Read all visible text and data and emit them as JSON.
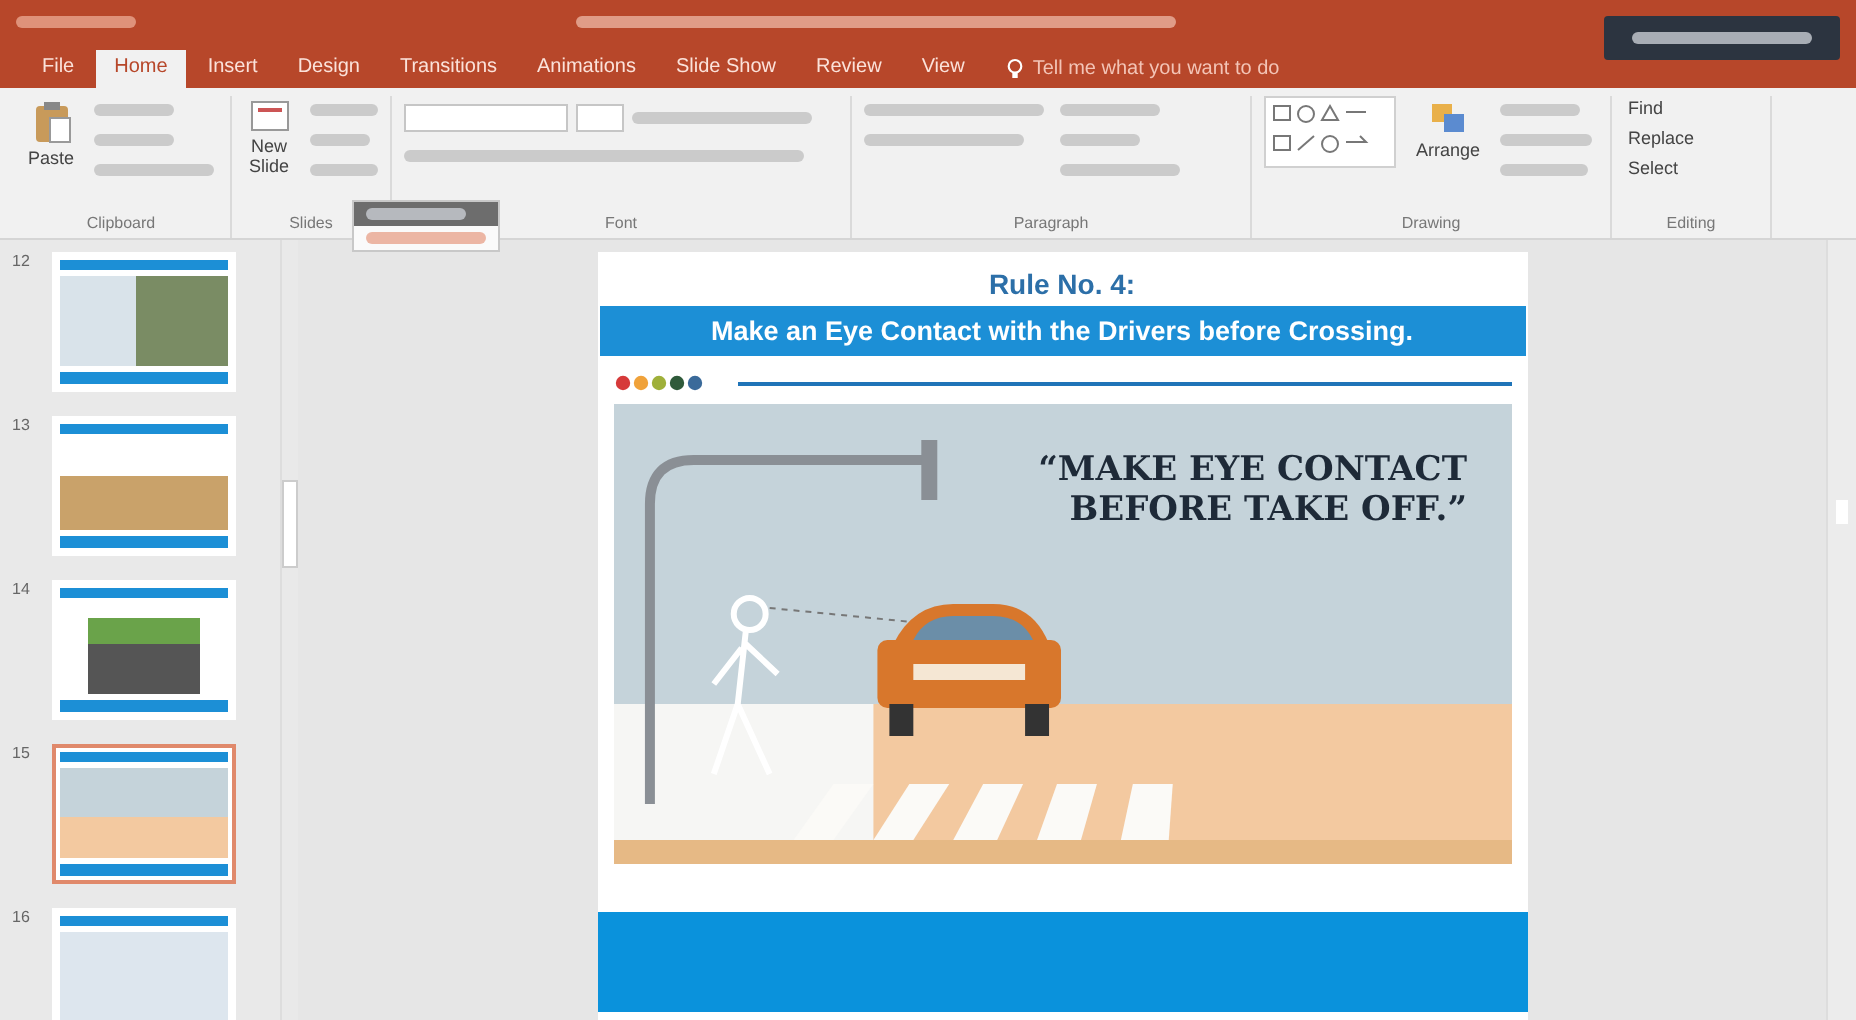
{
  "ribbon_tabs": [
    {
      "label": "File",
      "selected": false
    },
    {
      "label": "Home",
      "selected": true
    },
    {
      "label": "Insert",
      "selected": false
    },
    {
      "label": "Design",
      "selected": false
    },
    {
      "label": "Transitions",
      "selected": false
    },
    {
      "label": "Animations",
      "selected": false
    },
    {
      "label": "Slide Show",
      "selected": false
    },
    {
      "label": "Review",
      "selected": false
    },
    {
      "label": "View",
      "selected": false
    }
  ],
  "tell_me": {
    "placeholder": "Tell me what you want to do"
  },
  "ribbon_groups": [
    "Clipboard",
    "Slides",
    "Font",
    "Paragraph",
    "Drawing",
    "Editing"
  ],
  "ribbon_buttons": {
    "paste": "Paste",
    "new_slide": "New Slide",
    "arrange": "Arrange",
    "find": "Find",
    "replace": "Replace",
    "select": "Select"
  },
  "slide_thumbnails": [
    {
      "number": "12",
      "selected": false
    },
    {
      "number": "13",
      "selected": false
    },
    {
      "number": "14",
      "selected": false
    },
    {
      "number": "15",
      "selected": true
    },
    {
      "number": "16",
      "selected": false
    }
  ],
  "slide": {
    "heading": "Rule No. 4:",
    "banner": "Make an Eye Contact with the Drivers before Crossing.",
    "quote_lines": [
      "“MAKE EYE CONTACT",
      "BEFORE TAKE OFF.”"
    ]
  }
}
